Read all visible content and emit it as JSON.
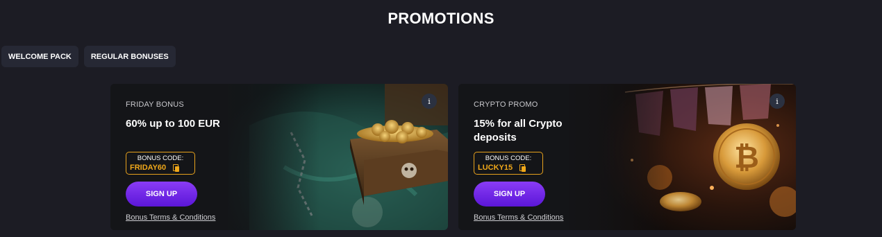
{
  "page": {
    "title": "PROMOTIONS"
  },
  "tabs": [
    {
      "label": "WELCOME PACK"
    },
    {
      "label": "REGULAR BONUSES"
    }
  ],
  "info_label": "i",
  "cards": [
    {
      "category": "FRIDAY BONUS",
      "offer": "60% up to 100 EUR",
      "code_title": "BONUS CODE:",
      "code": "FRIDAY60",
      "cta": "SIGN UP",
      "terms": "Bonus Terms & Conditions",
      "image": "treasure-chest-with-gold-coins"
    },
    {
      "category": "CRYPTO PROMO",
      "offer": "15% for all Crypto deposits",
      "code_title": "BONUS CODE:",
      "code": "LUCKY15",
      "cta": "SIGN UP",
      "terms": "Bonus Terms & Conditions",
      "image": "glowing-bitcoin-coins"
    }
  ],
  "colors": {
    "background": "#1c1c24",
    "accent_gold": "#f0a81a",
    "button_purple": "#7a2ef0"
  }
}
